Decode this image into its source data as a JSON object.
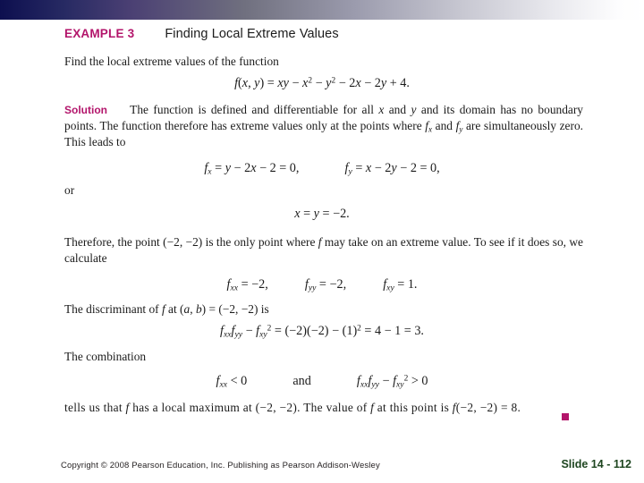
{
  "slide": {
    "example_label": "EXAMPLE 3",
    "example_title": "Finding Local Extreme Values",
    "prompt": "Find the local extreme values of the function",
    "function_eq": "f(x, y) = xy − x² − y² − 2x − 2y + 4.",
    "solution_label": "Solution",
    "solution_text": "The function is defined and differentiable for all x and y and its domain has no boundary points. The function therefore has extreme values only at the points where fₓ and fᵧ are simultaneously zero. This leads to",
    "partial_x_eq": "fₓ = y − 2x − 2 = 0,",
    "partial_y_eq": "fᵧ = x − 2y − 2 = 0,",
    "or_word": "or",
    "critical_point_eq": "x = y = −2.",
    "therefore_text": "Therefore, the point (−2, −2) is the only point where f may take on an extreme value. To see if it does so, we calculate",
    "fxx_eq": "fₓₓ = −2,",
    "fyy_eq": "fᵧᵧ = −2,",
    "fxy_eq": "fₓᵧ = 1.",
    "discriminant_text": "The discriminant of f at (a, b) = (−2, −2) is",
    "discriminant_eq": "fₓₓfᵧᵧ − fₓᵧ² = (−2)(−2) − (1)² = 4 − 1 = 3.",
    "combination_text": "The combination",
    "combination_eq_left": "fₓₓ < 0",
    "combination_and": "and",
    "combination_eq_right": "fₓₓfᵧᵧ − fₓᵧ² > 0",
    "conclusion_text": "tells us that f has a local maximum at (−2, −2). The value of f at this point is f(−2, −2) = 8."
  },
  "footer": {
    "copyright": "Copyright © 2008 Pearson Education, Inc. Publishing as Pearson Addison-Wesley",
    "slide_number": "Slide 14 - 112"
  },
  "colors": {
    "accent_magenta": "#b3156b",
    "slide_number_green": "#1e4620",
    "band_dark": "#0d0f4f"
  }
}
